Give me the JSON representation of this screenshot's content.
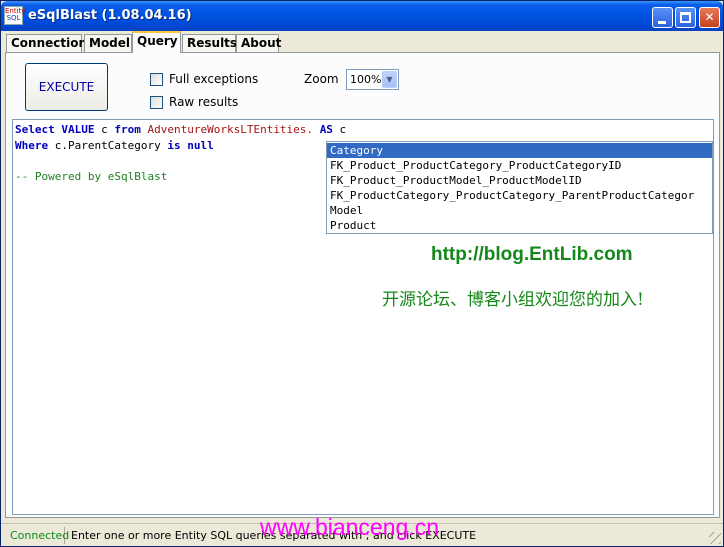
{
  "window": {
    "title": "eSqlBlast (1.08.04.16)",
    "icon_text": [
      "Entity",
      "SQL"
    ],
    "controls": {
      "minimize": "_",
      "maximize": "□",
      "close": "✕"
    }
  },
  "tabs": [
    {
      "label": "Connection",
      "active": false
    },
    {
      "label": "Model",
      "active": false
    },
    {
      "label": "Query",
      "active": true
    },
    {
      "label": "Results",
      "active": false
    },
    {
      "label": "About",
      "active": false
    }
  ],
  "toolbar": {
    "execute_label": "EXECUTE",
    "full_exceptions_label": "Full exceptions",
    "full_exceptions_checked": false,
    "raw_results_label": "Raw results",
    "raw_results_checked": false,
    "zoom_label": "Zoom",
    "zoom_value": "100%",
    "zoom_arrow": "▼"
  },
  "editor": {
    "line1": {
      "kw1": "Select VALUE",
      "t1": " c ",
      "kw2": "from",
      "t2": " ",
      "entity": "AdventureWorksLTEntities.",
      "t3": " ",
      "kw3": "AS",
      "t4": " c"
    },
    "line2": {
      "kw1": "Where",
      "t1": " c.ParentCategory ",
      "kw2": "is null"
    },
    "comment": "-- Powered by eSqlBlast"
  },
  "autocomplete": {
    "items": [
      "Category",
      "FK_Product_ProductCategory_ProductCategoryID",
      "FK_Product_ProductModel_ProductModelID",
      "FK_ProductCategory_ProductCategory_ParentProductCategor",
      "Model",
      "Product"
    ],
    "selected_index": 0
  },
  "watermark": {
    "url": "http://blog.EntLib.com",
    "chinese": "开源论坛、博客小组欢迎您的加入!",
    "bottom": "www.bianceng.cn"
  },
  "status": {
    "connection": "Connected",
    "message": "Enter one or more Entity SQL queries separated with ; and click EXECUTE"
  },
  "colors": {
    "titlebar": "#0054e3",
    "keyword": "#0000c0",
    "entity": "#a31515",
    "comment": "#208020",
    "selection": "#316ac5",
    "watermark_green": "#15881a",
    "watermark_magenta": "#ff00ff",
    "connected": "#0a8a1a"
  }
}
